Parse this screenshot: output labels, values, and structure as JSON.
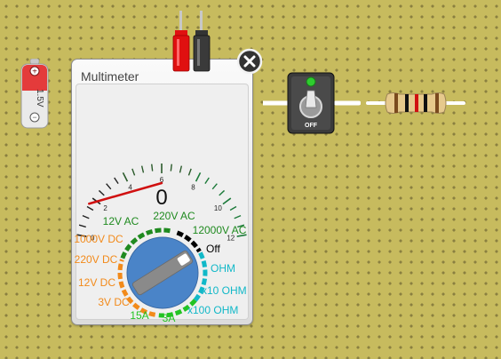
{
  "battery": {
    "label": "1.5V",
    "plus": "+",
    "minus": "−"
  },
  "multimeter": {
    "title": "Multimeter",
    "reading": "0",
    "scale_ticks": [
      "0",
      "2",
      "4",
      "6",
      "8",
      "10",
      "12"
    ],
    "needle_value": 0,
    "modes": [
      {
        "label": "12V AC",
        "color": "#1f8a1f"
      },
      {
        "label": "220V AC",
        "color": "#1f8a1f"
      },
      {
        "label": "12000V AC",
        "color": "#1f8a1f"
      },
      {
        "label": "Off",
        "color": "#000000"
      },
      {
        "label": "OHM",
        "color": "#11b8c8"
      },
      {
        "label": "x10 OHM",
        "color": "#11b8c8"
      },
      {
        "label": "x100 OHM",
        "color": "#11b8c8"
      },
      {
        "label": "3A",
        "color": "#22c322"
      },
      {
        "label": "15A",
        "color": "#22c322"
      },
      {
        "label": "3V DC",
        "color": "#f28a1a"
      },
      {
        "label": "12V DC",
        "color": "#f28a1a"
      },
      {
        "label": "220V DC",
        "color": "#f28a1a"
      },
      {
        "label": "1000V DC",
        "color": "#f28a1a"
      }
    ],
    "selected_mode": "Off"
  },
  "switch": {
    "label": "OFF",
    "state": "off",
    "indicator_color": "#2ecc2e"
  },
  "colors": {
    "breadboard": "#c7bb5e",
    "probe_red": "#e01010",
    "probe_black": "#333333",
    "dial_blue": "#4a84c8",
    "needle": "#d01010"
  }
}
